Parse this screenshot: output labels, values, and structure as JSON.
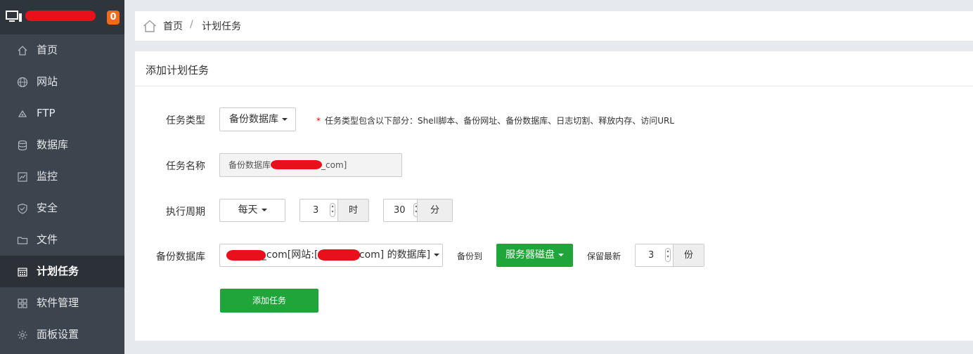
{
  "sidebar": {
    "badge": "0",
    "items": [
      {
        "label": "首页",
        "icon": "home-icon"
      },
      {
        "label": "网站",
        "icon": "globe-icon"
      },
      {
        "label": "FTP",
        "icon": "ftp-icon"
      },
      {
        "label": "数据库",
        "icon": "database-icon"
      },
      {
        "label": "监控",
        "icon": "monitor-chart-icon"
      },
      {
        "label": "安全",
        "icon": "shield-icon"
      },
      {
        "label": "文件",
        "icon": "folder-icon"
      },
      {
        "label": "计划任务",
        "icon": "calendar-icon"
      },
      {
        "label": "软件管理",
        "icon": "grid-icon"
      },
      {
        "label": "面板设置",
        "icon": "gear-icon"
      }
    ],
    "active_index": 7
  },
  "breadcrumb": {
    "home": "首页",
    "separator": "/",
    "current": "计划任务"
  },
  "panel": {
    "title": "添加计划任务",
    "task_type": {
      "label": "任务类型",
      "value": "备份数据库",
      "tip_star": "*",
      "tip": "任务类型包含以下部分：Shell脚本、备份网址、备份数据库、日志切割、释放内存、访问URL"
    },
    "task_name": {
      "label": "任务名称",
      "value_prefix": "备份数据库",
      "value_suffix": "_com]"
    },
    "period": {
      "label": "执行周期",
      "cycle": "每天",
      "hour": "3",
      "hour_unit": "时",
      "minute": "30",
      "minute_unit": "分"
    },
    "backup": {
      "label": "备份数据库",
      "db_part1": "n_com[网站:[",
      "db_part2": ".com] 的数据库]",
      "backup_to_label": "备份到",
      "backup_to": "服务器磁盘",
      "keep_label": "保留最新",
      "keep_count": "3",
      "keep_unit": "份"
    },
    "submit": "添加任务"
  }
}
